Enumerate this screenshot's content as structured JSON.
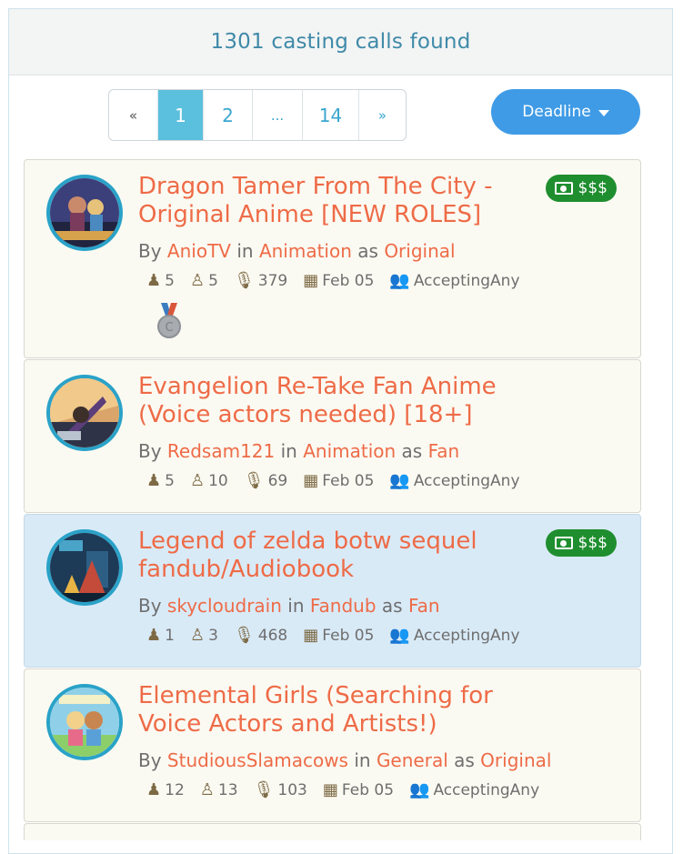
{
  "header": {
    "results_text": "1301 casting calls found"
  },
  "pagination": {
    "prev": "«",
    "pages": [
      "1",
      "2",
      "...",
      "14"
    ],
    "next": "»",
    "active": "1"
  },
  "sort": {
    "label": "Deadline"
  },
  "colors": {
    "accent_orange": "#ee6b47",
    "money_green": "#1f8e2f",
    "active_page": "#5bc0de",
    "sort_button": "#3f9be6",
    "highlight_card": "#d9eaf7"
  },
  "cards": [
    {
      "title": "Dragon Tamer From The City - Original Anime [NEW ROLES]",
      "badge": "$$$",
      "by": "By",
      "author": "AnioTV",
      "in": "in",
      "category": "Animation",
      "as": "as",
      "type": "Original",
      "female_roles": "5",
      "male_roles": "5",
      "auditions": "379",
      "deadline": "Feb 05",
      "accepting": "AcceptingAny",
      "has_medal": true
    },
    {
      "title": "Evangelion Re-Take Fan Anime (Voice actors needed) [18+]",
      "badge": "",
      "by": "By",
      "author": "Redsam121",
      "in": "in",
      "category": "Animation",
      "as": "as",
      "type": "Fan",
      "female_roles": "5",
      "male_roles": "10",
      "auditions": "69",
      "deadline": "Feb 05",
      "accepting": "AcceptingAny"
    },
    {
      "title": "Legend of zelda botw sequel fandub/Audiobook",
      "badge": "$$$",
      "by": "By",
      "author": "skycloudrain",
      "in": "in",
      "category": "Fandub",
      "as": "as",
      "type": "Fan",
      "female_roles": "1",
      "male_roles": "3",
      "auditions": "468",
      "deadline": "Feb 05",
      "accepting": "AcceptingAny",
      "highlighted": true
    },
    {
      "title": "Elemental Girls (Searching for Voice Actors and Artists!)",
      "badge": "",
      "by": "By",
      "author": "StudiousSlamacows",
      "in": "in",
      "category": "General",
      "as": "as",
      "type": "Original",
      "female_roles": "12",
      "male_roles": "13",
      "auditions": "103",
      "deadline": "Feb 05",
      "accepting": "AcceptingAny"
    }
  ],
  "icons": {
    "female": "female-role-icon",
    "male": "male-role-icon",
    "mic": "microphone-icon",
    "calendar": "calendar-icon",
    "group": "group-icon",
    "money": "money-icon"
  }
}
